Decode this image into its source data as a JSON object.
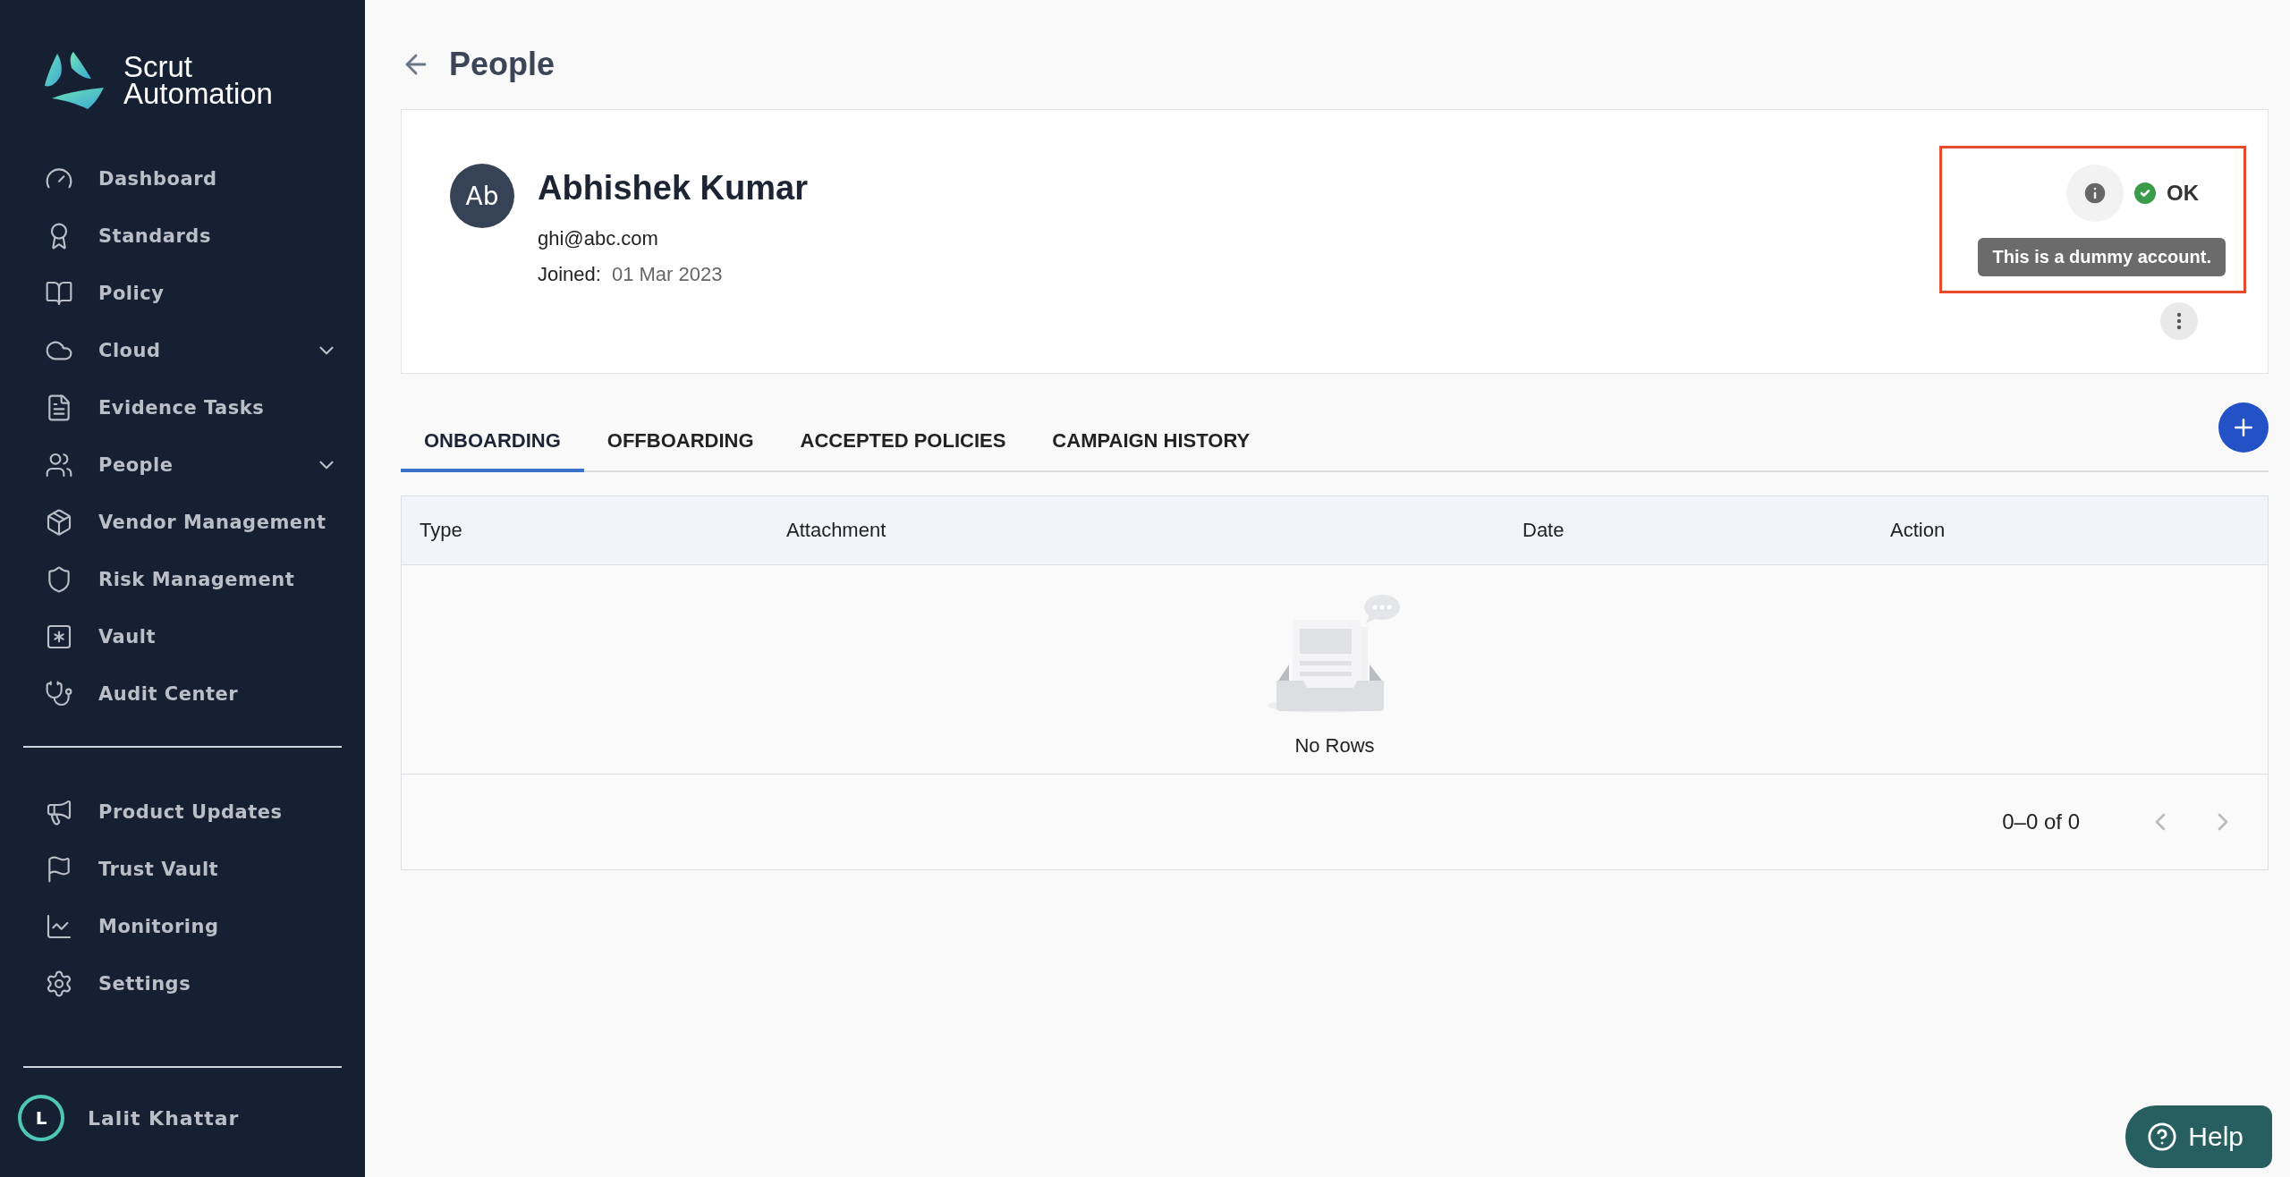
{
  "sidebar": {
    "logo": {
      "line1": "Scrut",
      "line2": "Automation"
    },
    "items": [
      {
        "label": "Dashboard",
        "has_submenu": false
      },
      {
        "label": "Standards",
        "has_submenu": false
      },
      {
        "label": "Policy",
        "has_submenu": false
      },
      {
        "label": "Cloud",
        "has_submenu": true
      },
      {
        "label": "Evidence Tasks",
        "has_submenu": false
      },
      {
        "label": "People",
        "has_submenu": true
      },
      {
        "label": "Vendor Management",
        "has_submenu": false
      },
      {
        "label": "Risk Management",
        "has_submenu": false
      },
      {
        "label": "Vault",
        "has_submenu": false
      },
      {
        "label": "Audit Center",
        "has_submenu": false
      }
    ],
    "footer_items": [
      {
        "label": "Product Updates"
      },
      {
        "label": "Trust Vault"
      },
      {
        "label": "Monitoring"
      },
      {
        "label": "Settings"
      }
    ],
    "user": {
      "initial": "L",
      "name": "Lalit Khattar"
    }
  },
  "page": {
    "title": "People"
  },
  "profile": {
    "initials": "Ab",
    "name": "Abhishek Kumar",
    "email": "ghi@abc.com",
    "joined_label": "Joined:",
    "joined_value": "01 Mar 2023",
    "status": "OK",
    "tooltip": "This is a dummy account."
  },
  "tabs": [
    {
      "label": "ONBOARDING",
      "selected": true
    },
    {
      "label": "OFFBOARDING",
      "selected": false
    },
    {
      "label": "ACCEPTED POLICIES",
      "selected": false
    },
    {
      "label": "CAMPAIGN HISTORY",
      "selected": false
    }
  ],
  "table": {
    "columns": [
      "Type",
      "Attachment",
      "Date",
      "Action"
    ],
    "empty_text": "No Rows",
    "pagination": "0–0 of 0"
  },
  "help": {
    "label": "Help"
  }
}
